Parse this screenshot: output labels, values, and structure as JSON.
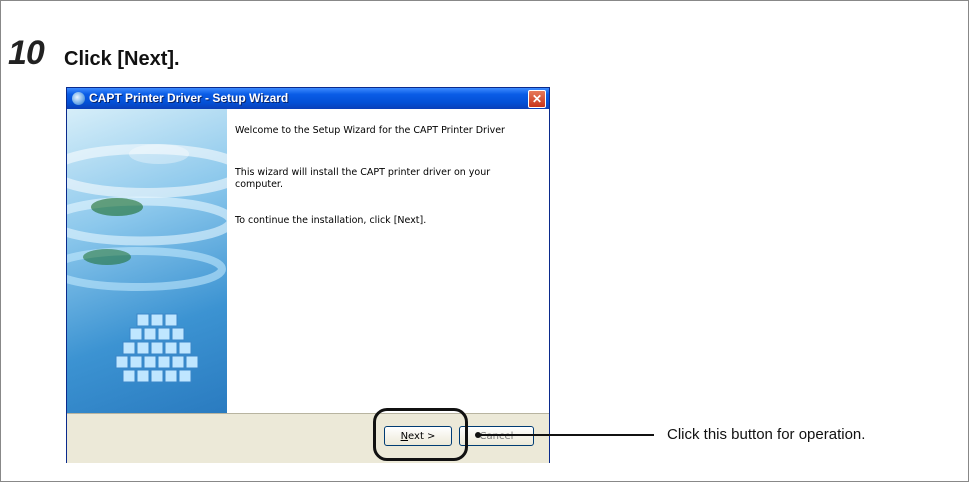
{
  "step": {
    "number": "10",
    "title": "Click [Next]."
  },
  "window": {
    "title": "CAPT Printer Driver - Setup Wizard",
    "close_label": "✕",
    "paragraphs": [
      "Welcome to the Setup Wizard for the CAPT Printer Driver",
      "This wizard will install the CAPT printer driver on your computer.",
      "To continue the installation, click [Next]."
    ],
    "next_prefix": "N",
    "next_rest": "ext >",
    "cancel_label": "Cancel"
  },
  "callout": {
    "text": "Click this button for operation."
  },
  "colors": {
    "titlebar": "#0350d6",
    "dialog_bg": "#ece9d8",
    "highlight": "#111111"
  },
  "icons": [
    "setup-app-icon",
    "close-icon"
  ]
}
